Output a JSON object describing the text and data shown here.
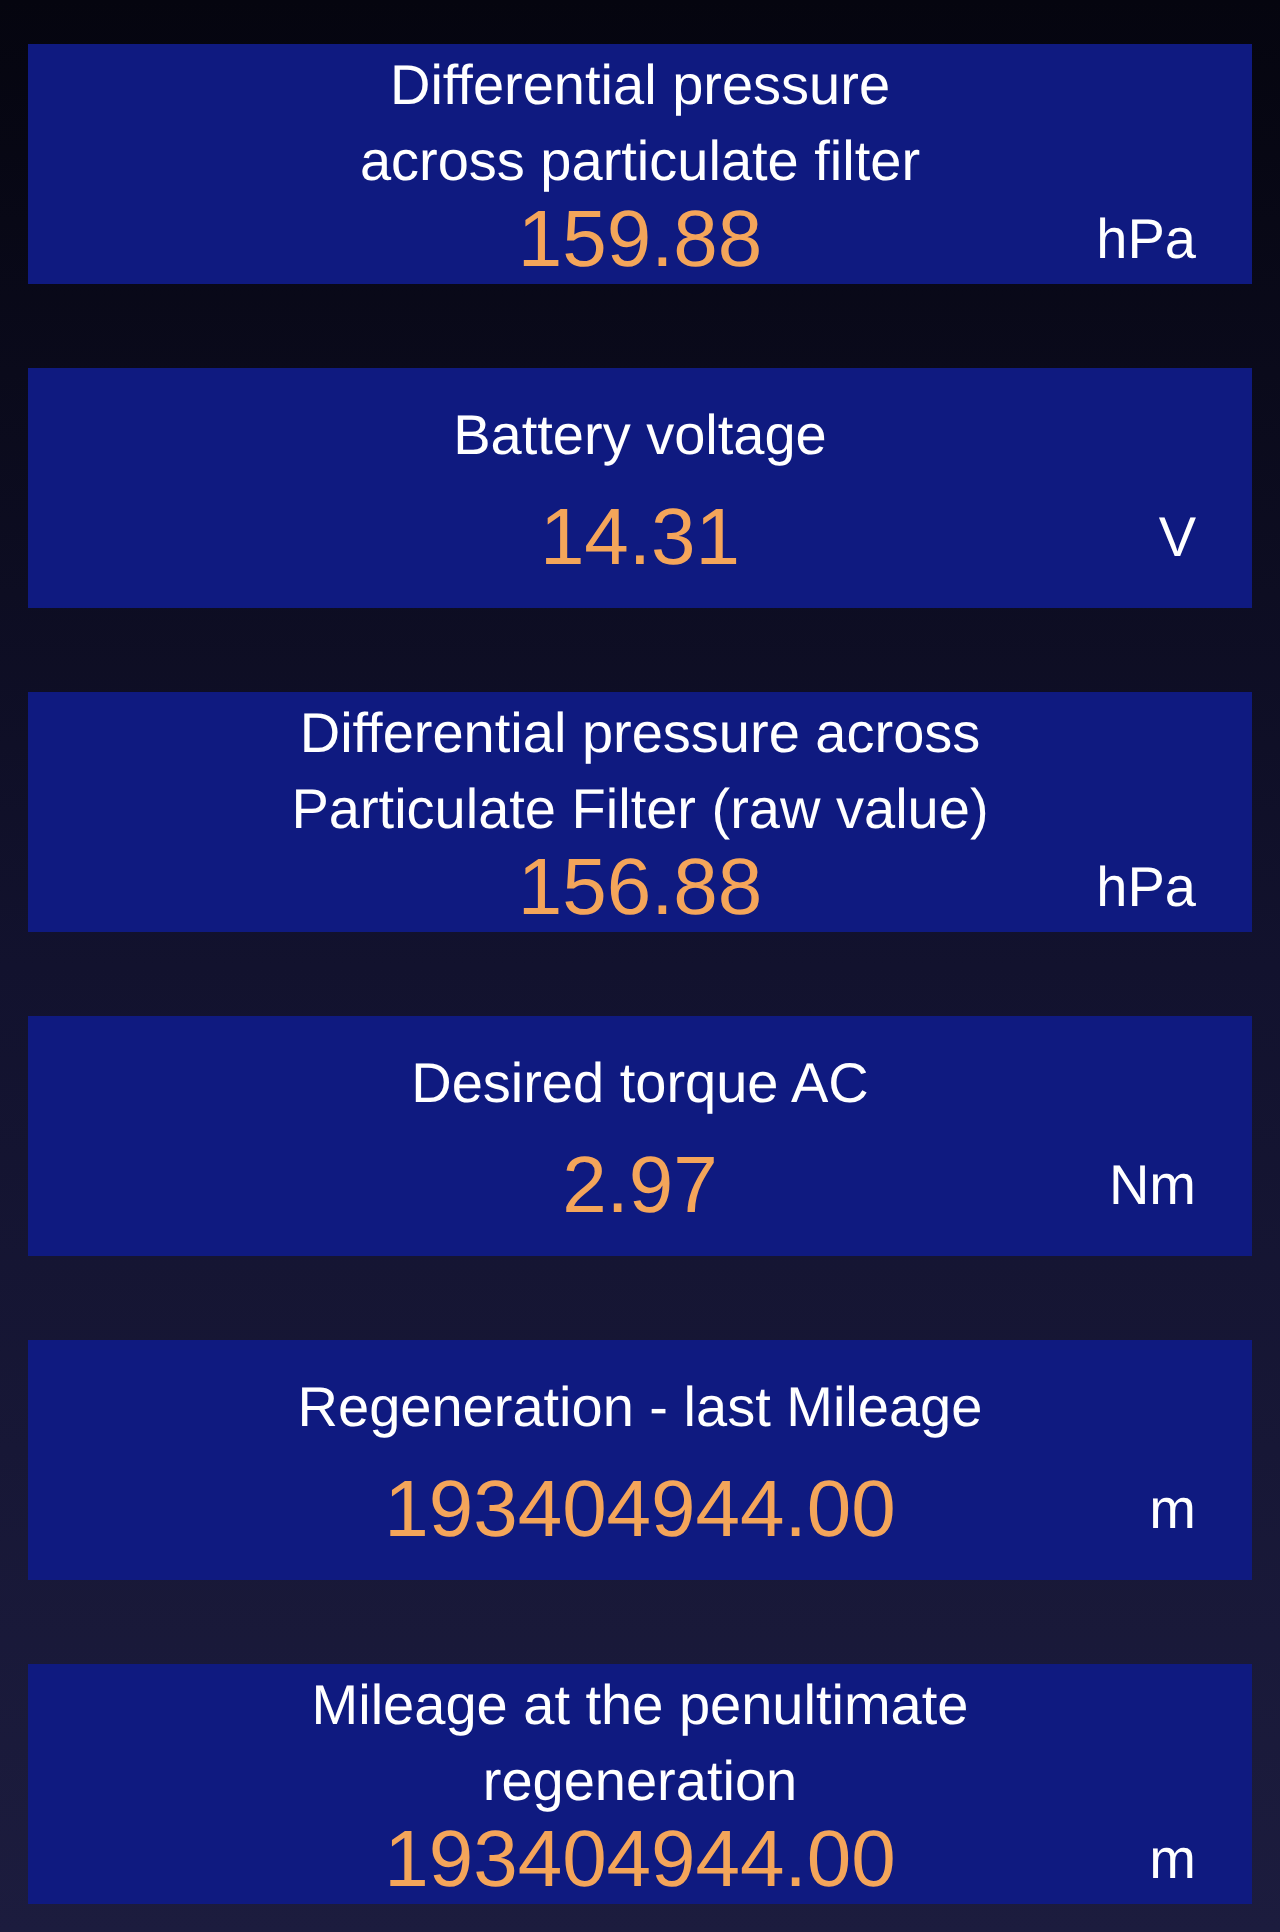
{
  "readings": [
    {
      "title": "Differential pressure\nacross particulate filter",
      "value": "159.88",
      "unit": "hPa"
    },
    {
      "title": "Battery voltage",
      "value": "14.31",
      "unit": "V"
    },
    {
      "title": "Differential pressure across\nParticulate Filter (raw value)",
      "value": "156.88",
      "unit": "hPa"
    },
    {
      "title": "Desired torque AC",
      "value": "2.97",
      "unit": "Nm"
    },
    {
      "title": "Regeneration - last Mileage",
      "value": "193404944.00",
      "unit": "m"
    },
    {
      "title": "Mileage at the penultimate\nregeneration",
      "value": "193404944.00",
      "unit": "m"
    }
  ]
}
